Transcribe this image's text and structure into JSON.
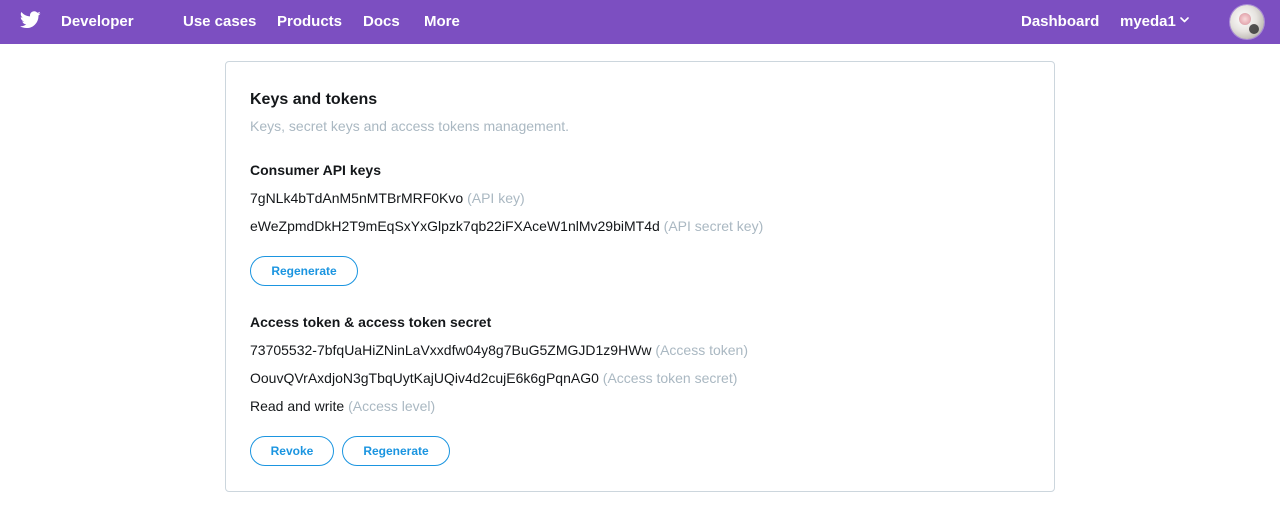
{
  "colors": {
    "nav_bg": "#7c4fc1",
    "link_blue": "#1b95e0",
    "muted_text": "#aab8c2",
    "border": "#ccd6dd"
  },
  "topnav": {
    "logo_icon": "twitter-bird-icon",
    "brand": "Developer",
    "links": [
      "Use cases",
      "Products",
      "Docs",
      "More"
    ],
    "dashboard": "Dashboard",
    "username": "myeda1",
    "dropdown_icon": "chevron-down-icon",
    "avatar_icon": "user-avatar"
  },
  "card": {
    "title": "Keys and tokens",
    "subtitle": "Keys, secret keys and access tokens management.",
    "consumer": {
      "heading": "Consumer API keys",
      "api_key": "7gNLk4bTdAnM5nMTBrMRF0Kvo",
      "api_key_label": "(API key)",
      "api_secret": "eWeZpmdDkH2T9mEqSxYxGlpzk7qb22iFXAceW1nlMv29biMT4d",
      "api_secret_label": "(API secret key)",
      "regenerate": "Regenerate"
    },
    "access": {
      "heading": "Access token & access token secret",
      "token": "73705532-7bfqUaHiZNinLaVxxdfw04y8g7BuG5ZMGJD1z9HWw",
      "token_label": "(Access token)",
      "secret": "OouvQVrAxdjoN3gTbqUytKajUQiv4d2cujE6k6gPqnAG0",
      "secret_label": "(Access token secret)",
      "level": "Read and write",
      "level_label": "(Access level)",
      "revoke": "Revoke",
      "regenerate": "Regenerate"
    }
  }
}
